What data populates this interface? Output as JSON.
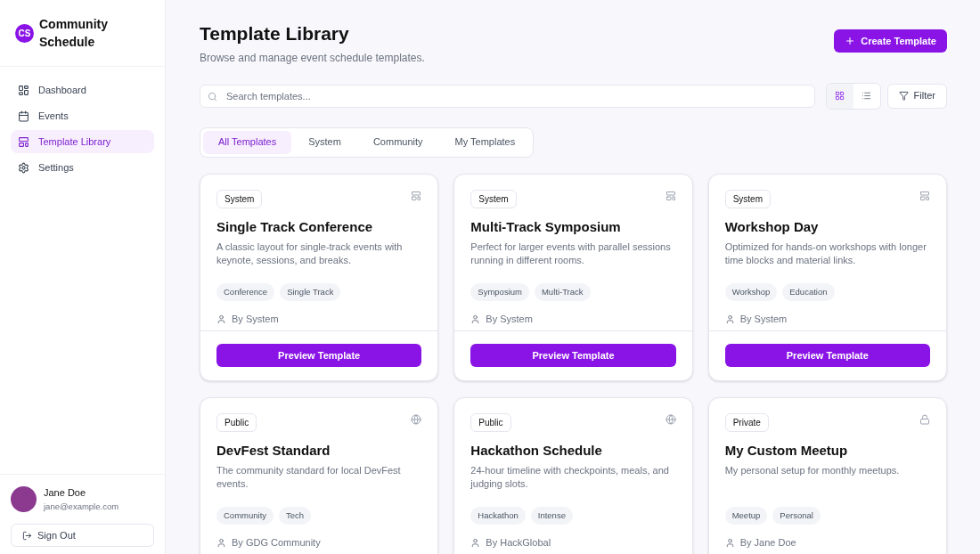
{
  "app": {
    "logo": "CS",
    "name": "Community Schedule"
  },
  "nav": [
    {
      "label": "Dashboard",
      "kind": "dashboard",
      "selected": false
    },
    {
      "label": "Events",
      "kind": "calendar",
      "selected": false
    },
    {
      "label": "Template Library",
      "kind": "layout",
      "selected": true
    },
    {
      "label": "Settings",
      "kind": "settings",
      "selected": false
    }
  ],
  "user": {
    "name": "Jane Doe",
    "email": "jane@example.com",
    "sign_out": "Sign Out"
  },
  "header": {
    "title": "Template Library",
    "subtitle": "Browse and manage event schedule templates.",
    "create_button": "Create Template"
  },
  "search": {
    "placeholder": "Search templates..."
  },
  "view_toggle": [
    {
      "kind": "grid",
      "selected": true
    },
    {
      "kind": "list",
      "selected": false
    }
  ],
  "filter_button": "Filter",
  "tabs": [
    {
      "label": "All Templates",
      "selected": true
    },
    {
      "label": "System",
      "selected": false
    },
    {
      "label": "Community",
      "selected": false
    },
    {
      "label": "My Templates",
      "selected": false
    }
  ],
  "templates": [
    {
      "badge": "System",
      "kind": "system",
      "title": "Single Track Conference",
      "description": "A classic layout for single-track events with keynote, sessions, and breaks.",
      "tags": [
        "Conference",
        "Single Track"
      ],
      "author": "By System",
      "button": "Preview Template"
    },
    {
      "badge": "System",
      "kind": "system",
      "title": "Multi-Track Symposium",
      "description": "Perfect for larger events with parallel sessions running in different rooms.",
      "tags": [
        "Symposium",
        "Multi-Track"
      ],
      "author": "By System",
      "button": "Preview Template"
    },
    {
      "badge": "System",
      "kind": "system",
      "title": "Workshop Day",
      "description": "Optimized for hands-on workshops with longer time blocks and material links.",
      "tags": [
        "Workshop",
        "Education"
      ],
      "author": "By System",
      "button": "Preview Template"
    },
    {
      "badge": "Public",
      "kind": "public",
      "title": "DevFest Standard",
      "description": "The community standard for local DevFest events.",
      "tags": [
        "Community",
        "Tech"
      ],
      "author": "By GDG Community"
    },
    {
      "badge": "Public",
      "kind": "public",
      "title": "Hackathon Schedule",
      "description": "24-hour timeline with checkpoints, meals, and judging slots.",
      "tags": [
        "Hackathon",
        "Intense"
      ],
      "author": "By HackGlobal"
    },
    {
      "badge": "Private",
      "kind": "private",
      "title": "My Custom Meetup",
      "description": "My personal setup for monthly meetups.",
      "tags": [
        "Meetup",
        "Personal"
      ],
      "author": "By Jane Doe"
    }
  ]
}
